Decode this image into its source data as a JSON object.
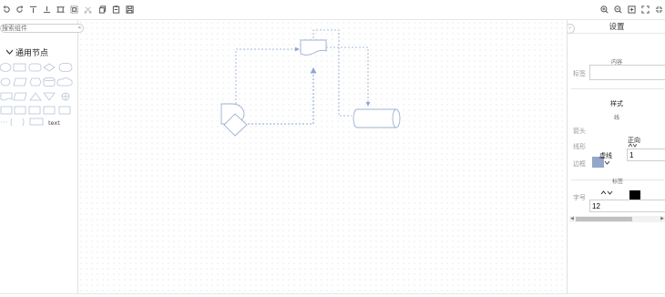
{
  "toolbar": {
    "left_icons": [
      "undo-icon",
      "redo-icon",
      "align-top-icon",
      "align-bottom-icon",
      "fit-selection-icon",
      "select-all-icon",
      "cut-icon",
      "copy-icon",
      "paste-icon",
      "save-icon"
    ],
    "right_icons": [
      "zoom-in-icon",
      "zoom-out-icon",
      "fit-page-icon",
      "fullscreen-icon",
      "shrink-icon"
    ]
  },
  "left_panel": {
    "search_placeholder": "搜索组件",
    "collapse_glyph": "«",
    "group_title": "通用节点",
    "text_shape_label": "text"
  },
  "right_panel": {
    "title": "设置",
    "collapse_glyph": "»",
    "content_section": "内容",
    "label_field_label": "标签",
    "label_value": "",
    "style_section": "样式",
    "line_subsection": "线",
    "arrow_label": "箭头",
    "line_shape_label": "线形",
    "line_shape_value": "正向",
    "line_width_value": "1",
    "border_label": "边框",
    "border_style_value": "虚线",
    "border_color": "#94a7c9",
    "label_subsection": "标签",
    "font_size_label": "字号",
    "font_size_value": "12",
    "font_color": "#000000"
  },
  "colors": {
    "node_stroke": "#9bb0d3",
    "edge": "#8ea6cf"
  }
}
